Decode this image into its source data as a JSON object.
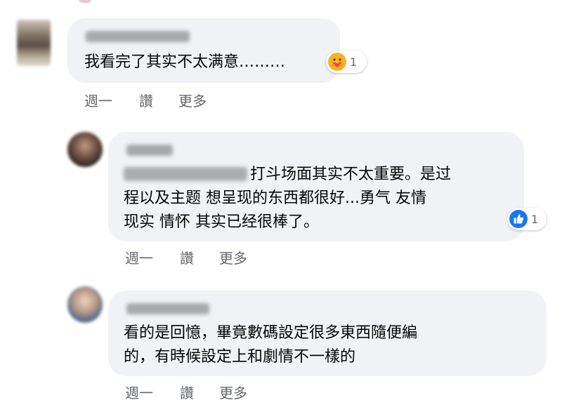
{
  "comments": [
    {
      "author": "",
      "lines": [
        "我看完了其实不太满意………"
      ],
      "reaction": {
        "icon": "care-reaction-icon",
        "count": "1"
      },
      "actions": {
        "time": "週一",
        "like": "讚",
        "more": "更多"
      }
    },
    {
      "author": "",
      "mention": "",
      "lines": [
        "打斗场面其实不太重要。是过",
        "程以及主题 想呈现的东西都很好...勇气 友情",
        "现实 情怀 其实已经很棒了。"
      ],
      "reaction": {
        "icon": "like-reaction-icon",
        "count": "1"
      },
      "actions": {
        "time": "週一",
        "like": "讚",
        "more": "更多"
      }
    },
    {
      "author": "",
      "lines": [
        "看的是回憶，畢竟數碼設定很多東西隨便編",
        "的，有時候設定上和劇情不一樣的"
      ],
      "actions": {
        "time": "週一",
        "like": "讚",
        "more": "更多"
      }
    }
  ],
  "colors": {
    "bubble": "#f0f2f5",
    "text": "#050505",
    "meta": "#65676b",
    "like_blue": "#1877f2",
    "care_yellow": "#f7b125"
  }
}
